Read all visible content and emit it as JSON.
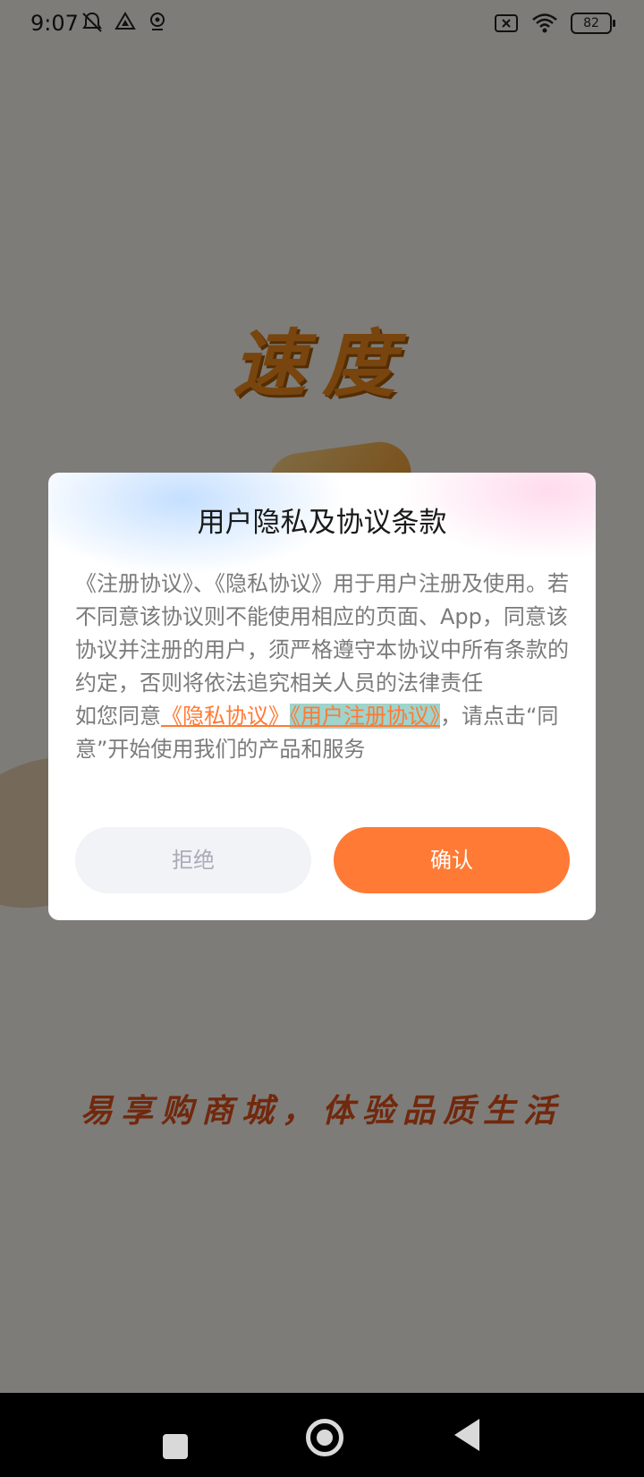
{
  "status_bar": {
    "time": "9:07",
    "battery_level": "82",
    "icons_left": [
      "mute-icon",
      "drive-icon",
      "location-icon"
    ],
    "icons_right": [
      "sim-x-icon",
      "wifi-icon",
      "battery-icon"
    ]
  },
  "background": {
    "splash_title": "速度",
    "slogan": "易享购商城，体验品质生活"
  },
  "dialog": {
    "title": "用户隐私及协议条款",
    "paragraph1": "《注册协议》、《隐私协议》用于用户注册及使用。若不同意该协议则不能使用相应的页面、App，同意该协议并注册的用户，须严格遵守本协议中所有条款的约定，否则将依法追究相关人员的法律责任",
    "paragraph2_prefix": "如您同意",
    "privacy_link": "《隐私协议》",
    "register_link": "《用户注册协议》",
    "paragraph2_suffix": "，请点击“同意”开始使用我们的产品和服务",
    "reject_label": "拒绝",
    "confirm_label": "确认"
  },
  "colors": {
    "accent": "#ff7a35",
    "overlay": "rgba(0,0,0,0.5)",
    "reject_bg": "#f2f3f7"
  },
  "nav_bar": {
    "icons": [
      "recents-square-icon",
      "home-circle-icon",
      "back-triangle-icon"
    ]
  }
}
